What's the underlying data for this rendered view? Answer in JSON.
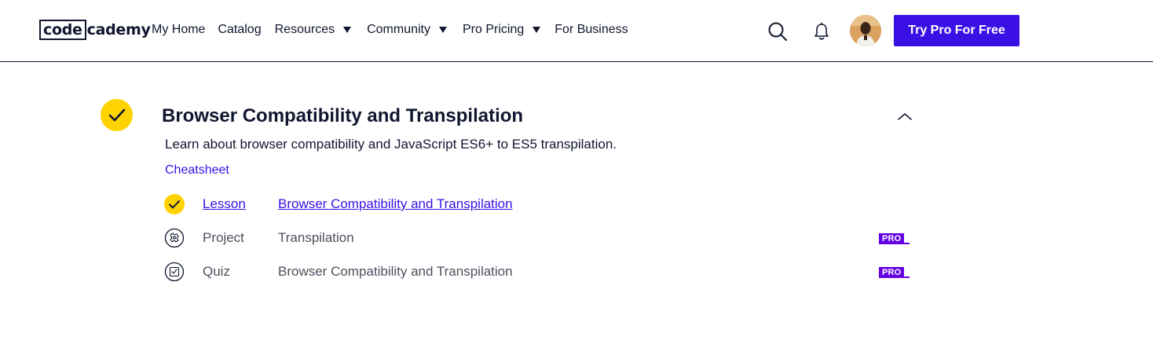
{
  "header": {
    "logo": {
      "boxed": "code",
      "rest": "cademy"
    },
    "nav": [
      {
        "label": "My Home"
      },
      {
        "label": "Catalog"
      },
      {
        "label": "Resources"
      },
      {
        "label": "Community"
      },
      {
        "label": "Pro Pricing"
      },
      {
        "label": "For Business"
      }
    ],
    "cta_label": "Try Pro For Free",
    "icons": {
      "search": "search-icon",
      "notifications": "bell-icon",
      "avatar": "user-avatar"
    }
  },
  "module": {
    "completed": true,
    "title": "Browser Compatibility and Transpilation",
    "description": "Learn about browser compatibility and JavaScript ES6+ to ES5 transpilation.",
    "cheatsheet_label": "Cheatsheet",
    "items": [
      {
        "type": "Lesson",
        "title": "Browser Compatibility and Transpilation",
        "status": "completed",
        "pro": false
      },
      {
        "type": "Project",
        "title": "Transpilation",
        "status": "not-started",
        "pro": true,
        "badge": "PRO"
      },
      {
        "type": "Quiz",
        "title": "Browser Compatibility and Transpilation",
        "status": "not-started",
        "pro": true,
        "badge": "PRO"
      }
    ]
  },
  "colors": {
    "brand": "#3a10e5",
    "complete": "#ffd300",
    "pro": "#6400e4",
    "text": "#10162f"
  }
}
